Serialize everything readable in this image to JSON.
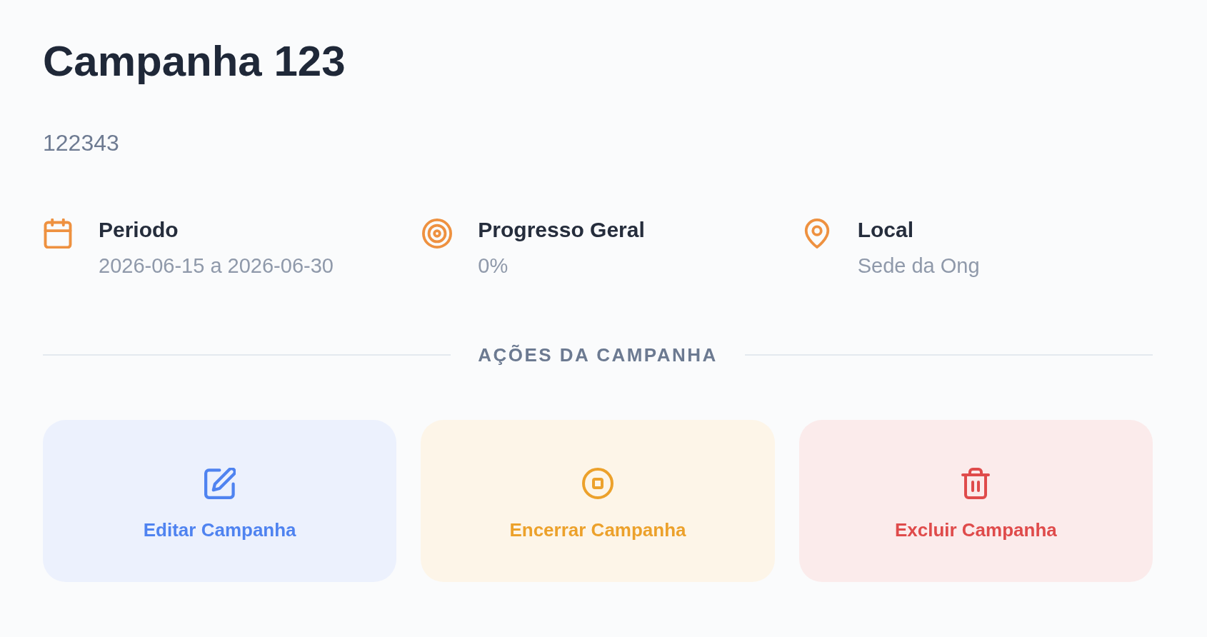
{
  "campaign": {
    "title": "Campanha 123",
    "code": "122343"
  },
  "details": [
    {
      "kind": "period",
      "label": "Periodo",
      "value": "2026-06-15 a 2026-06-30"
    },
    {
      "kind": "progress",
      "label": "Progresso Geral",
      "value": "0%"
    },
    {
      "kind": "location",
      "label": "Local",
      "value": "Sede da Ong"
    }
  ],
  "actions_heading": "AÇÕES DA CAMPANHA",
  "actions": [
    {
      "kind": "edit",
      "label": "Editar Campanha",
      "color": "#4f83f0"
    },
    {
      "kind": "close",
      "label": "Encerrar Campanha",
      "color": "#eca12b"
    },
    {
      "kind": "delete",
      "label": "Excluir Campanha",
      "color": "#df4b4b"
    }
  ]
}
